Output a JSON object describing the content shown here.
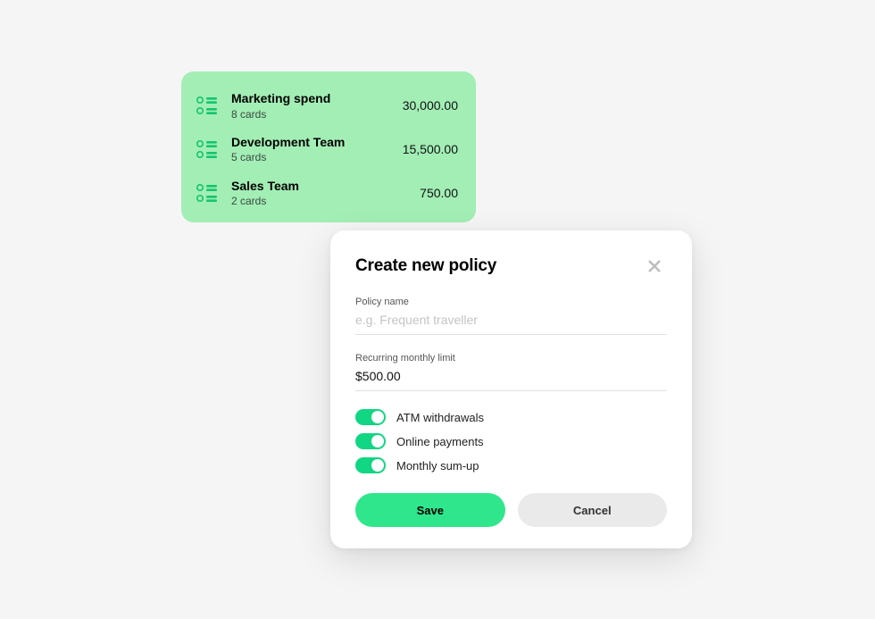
{
  "policies": [
    {
      "name": "Marketing spend",
      "sub": "8 cards",
      "amount": "30,000.00"
    },
    {
      "name": "Development Team",
      "sub": "5 cards",
      "amount": "15,500.00"
    },
    {
      "name": "Sales Team",
      "sub": "2 cards",
      "amount": "750.00"
    }
  ],
  "modal": {
    "title": "Create new policy",
    "policy_name_label": "Policy name",
    "policy_name_placeholder": "e.g. Frequent traveller",
    "policy_name_value": "",
    "limit_label": "Recurring monthly limit",
    "limit_value": "$500.00",
    "toggles": [
      {
        "label": "ATM withdrawals",
        "on": true
      },
      {
        "label": "Online payments",
        "on": true
      },
      {
        "label": "Monthly sum-up",
        "on": true
      }
    ],
    "save_label": "Save",
    "cancel_label": "Cancel"
  },
  "colors": {
    "accent": "#11d683",
    "card_green": "#a2eeb5"
  }
}
